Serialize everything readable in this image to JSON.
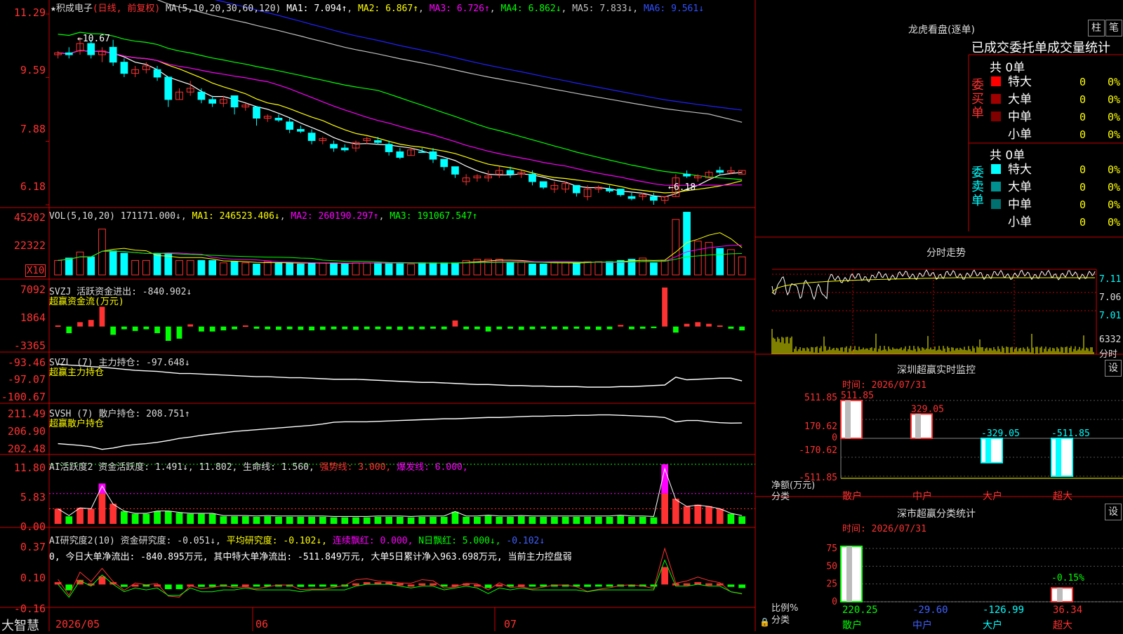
{
  "colors": {
    "up": "#ff3232",
    "down": "#00ffff",
    "grid": "#c80000",
    "ma1": "#ffffff",
    "ma2": "#ffff00",
    "ma3": "#ff00ff",
    "ma4": "#00ff00",
    "ma5": "#c0c0c0",
    "ma6": "#2020ff",
    "text": "#c8c8c8",
    "yellow": "#ffff00",
    "green": "#00ff00"
  },
  "header": {
    "star": "★",
    "title": "积成电子",
    "period": "(日线, 前复权)",
    "ma_label": "MA(5,10,20,30,60,120)",
    "ma1": "MA1: 7.094↑",
    "ma2": "MA2: 6.867↑",
    "ma3": "MA3: 6.726↑",
    "ma4": "MA4: 6.862↓",
    "ma5": "MA5: 7.833↓",
    "ma6": "MA6: 9.561↓"
  },
  "price_axis": [
    "11.29",
    "9.59",
    "7.88",
    "6.18"
  ],
  "annotations": {
    "high": "←10.67",
    "low": "←6.18"
  },
  "vol": {
    "label": "VOL(5,10,20)",
    "value": "171171.000↓",
    "ma1": "MA1: 246523.406↓",
    "ma2": "MA2: 260190.297↑",
    "ma3": "MA3: 191067.547↑",
    "axis": [
      "45202",
      "22322"
    ],
    "unit": "X10"
  },
  "svzj": {
    "label": "SVZJ 活跃资金进出: -840.902↓",
    "sub": "超赢资金流(万元)",
    "axis": [
      "7092",
      "1864",
      "-3365"
    ]
  },
  "svzl": {
    "label": "SVZL (7) 主力持仓: -97.648↓",
    "sub": "超赢主力持仓",
    "axis": [
      "-93.46",
      "-97.07",
      "-100.67"
    ]
  },
  "svsh": {
    "label": "SVSH (7) 散户持仓: 208.751↑",
    "sub": "超赢散户持仓",
    "axis": [
      "211.49",
      "206.90",
      "202.48"
    ]
  },
  "ai1": {
    "label": "AI活跃度2 资金活跃度: 1.491↓, 11.802, 生命线: 1.560,",
    "strong": "强势线: 3.000,",
    "burst": "爆发线: 6.000,",
    "axis": [
      "11.80",
      "5.83",
      "0.00"
    ]
  },
  "ai2": {
    "label": "AI研究度2(10) 资金研究度: -0.051↓,",
    "avg": "平均研究度: -0.102↓,",
    "cont": "连续飘红: 0.000,",
    "n": "N日飘红: 5.000↓,",
    "last": "-0.102↓",
    "line2": "0, 今日大单净流出: -840.895万元, 其中特大单净流出: -511.849万元, 大单5日累计净入963.698万元, 当前主力控盘弱",
    "axis": [
      "0.37",
      "0.10",
      "-0.16"
    ]
  },
  "xaxis": {
    "brand": "大智慧",
    "labels": [
      "2026/05",
      "06",
      "07"
    ]
  },
  "lhb": {
    "title": "龙虎看盘(逐单)",
    "btn1": "柱",
    "btn2": "笔",
    "tab1": "已成交",
    "tab2": "委托单",
    "tab3": "成交量统计",
    "buy": {
      "side": "委买单",
      "total": "共 0单",
      "rows": [
        {
          "name": "特大",
          "v": "0",
          "p": "0%",
          "c": "#ff0000"
        },
        {
          "name": "大单",
          "v": "0",
          "p": "0%",
          "c": "#a00000"
        },
        {
          "name": "中单",
          "v": "0",
          "p": "0%",
          "c": "#800000"
        },
        {
          "name": "小单",
          "v": "0",
          "p": "0%",
          "c": ""
        }
      ]
    },
    "sell": {
      "side": "委卖单",
      "total": "共 0单",
      "rows": [
        {
          "name": "特大",
          "v": "0",
          "p": "0%",
          "c": "#00ffff"
        },
        {
          "name": "大单",
          "v": "0",
          "p": "0%",
          "c": "#009090"
        },
        {
          "name": "中单",
          "v": "0",
          "p": "0%",
          "c": "#007070"
        },
        {
          "name": "小单",
          "v": "0",
          "p": "0%",
          "c": ""
        }
      ]
    }
  },
  "fenshi": {
    "title": "分时走势",
    "axis": [
      "7.11",
      "7.06",
      "7.01"
    ],
    "vol": "6332",
    "unit": "分时"
  },
  "monitor": {
    "title": "深圳超赢实时监控",
    "btn": "设",
    "time": "时间: 2026/07/31",
    "axis": [
      "511.85",
      "170.62",
      "0",
      "-170.62",
      "-511.85"
    ],
    "ylab": "净额(万元)",
    "xlab": "分类",
    "bars": [
      {
        "cat": "散户",
        "v": 511.85,
        "label": "511.85"
      },
      {
        "cat": "中户",
        "v": 329.05,
        "label": "329.05"
      },
      {
        "cat": "大户",
        "v": -329.05,
        "label": "-329.05"
      },
      {
        "cat": "超大",
        "v": -511.85,
        "label": "-511.85"
      }
    ]
  },
  "classify": {
    "title": "深市超赢分类统计",
    "btn": "设",
    "time": "时间: 2026/07/31",
    "axis": [
      "75",
      "50",
      "25",
      "0"
    ],
    "ylab": "比例%",
    "xlab": "分类",
    "bars": [
      {
        "cat": "散户",
        "v": 100,
        "vlabel": "220.25"
      },
      {
        "cat": "中户",
        "v": 0,
        "vlabel": "-29.60"
      },
      {
        "cat": "大户",
        "v": 0,
        "vlabel": "-126.99"
      },
      {
        "cat": "超大",
        "v": 25,
        "vlabel": "36.34",
        "top": "-0.15%"
      }
    ]
  },
  "chart_data": [
    {
      "type": "candlestick",
      "title": "积成电子",
      "ylim": [
        6.18,
        11.29
      ],
      "ohlc": [
        [
          10.2,
          10.3,
          10.1,
          10.25
        ],
        [
          10.25,
          10.4,
          10.1,
          10.2
        ],
        [
          10.3,
          10.67,
          10.2,
          10.5
        ],
        [
          10.5,
          10.6,
          10.1,
          10.2
        ],
        [
          10.2,
          10.4,
          10.0,
          10.3
        ],
        [
          10.4,
          10.6,
          9.9,
          10.0
        ],
        [
          10.0,
          10.1,
          9.6,
          9.7
        ],
        [
          9.7,
          9.9,
          9.6,
          9.8
        ],
        [
          9.8,
          10.0,
          9.7,
          9.9
        ],
        [
          9.8,
          9.9,
          9.5,
          9.6
        ],
        [
          9.6,
          9.6,
          8.8,
          9.0
        ],
        [
          9.0,
          9.3,
          9.0,
          9.2
        ],
        [
          9.2,
          9.5,
          9.1,
          9.3
        ],
        [
          9.2,
          9.3,
          8.9,
          9.0
        ],
        [
          9.0,
          9.1,
          8.8,
          8.9
        ],
        [
          8.9,
          9.1,
          8.8,
          9.0
        ],
        [
          9.1,
          9.1,
          8.6,
          8.8
        ],
        [
          8.8,
          8.9,
          8.7,
          8.85
        ],
        [
          8.8,
          8.8,
          8.3,
          8.5
        ],
        [
          8.5,
          8.6,
          8.4,
          8.55
        ],
        [
          8.5,
          8.6,
          8.4,
          8.45
        ],
        [
          8.4,
          8.5,
          8.1,
          8.2
        ],
        [
          8.2,
          8.3,
          8.1,
          8.15
        ],
        [
          8.1,
          8.2,
          7.8,
          7.9
        ],
        [
          7.9,
          8.0,
          7.8,
          7.95
        ],
        [
          7.8,
          7.9,
          7.6,
          7.7
        ],
        [
          7.7,
          7.8,
          7.6,
          7.65
        ],
        [
          7.7,
          7.9,
          7.6,
          7.85
        ],
        [
          7.9,
          8.0,
          7.8,
          7.95
        ],
        [
          7.9,
          8.0,
          7.8,
          7.85
        ],
        [
          7.8,
          7.9,
          7.5,
          7.6
        ],
        [
          7.6,
          7.7,
          7.4,
          7.45
        ],
        [
          7.5,
          7.7,
          7.5,
          7.65
        ],
        [
          7.6,
          7.7,
          7.6,
          7.58
        ],
        [
          7.6,
          7.7,
          7.3,
          7.4
        ],
        [
          7.4,
          7.4,
          7.1,
          7.2
        ],
        [
          7.2,
          7.2,
          6.9,
          7.0
        ],
        [
          6.8,
          7.0,
          6.7,
          6.9
        ],
        [
          6.9,
          7.0,
          6.8,
          6.95
        ],
        [
          6.9,
          7.1,
          6.8,
          6.95
        ],
        [
          7.0,
          7.2,
          6.9,
          7.1
        ],
        [
          7.1,
          7.2,
          6.9,
          7.0
        ],
        [
          7.0,
          7.1,
          6.9,
          7.05
        ],
        [
          7.0,
          7.1,
          6.7,
          6.8
        ],
        [
          6.8,
          6.8,
          6.6,
          6.65
        ],
        [
          6.6,
          6.8,
          6.5,
          6.7
        ],
        [
          6.6,
          6.8,
          6.5,
          6.75
        ],
        [
          6.7,
          6.7,
          6.4,
          6.5
        ],
        [
          6.4,
          6.7,
          6.3,
          6.6
        ],
        [
          6.6,
          6.7,
          6.5,
          6.65
        ],
        [
          6.6,
          6.7,
          6.5,
          6.55
        ],
        [
          6.6,
          6.6,
          6.4,
          6.45
        ],
        [
          6.4,
          6.5,
          6.3,
          6.35
        ],
        [
          6.4,
          6.5,
          6.3,
          6.45
        ],
        [
          6.4,
          6.5,
          6.18,
          6.3
        ],
        [
          6.3,
          6.4,
          6.2,
          6.4
        ],
        [
          6.4,
          7.0,
          6.4,
          6.9
        ],
        [
          7.0,
          7.1,
          6.9,
          6.95
        ],
        [
          6.9,
          7.0,
          6.8,
          6.95
        ],
        [
          6.9,
          7.1,
          6.9,
          7.05
        ],
        [
          7.1,
          7.2,
          7.0,
          7.05
        ],
        [
          7.05,
          7.2,
          7.0,
          7.09
        ],
        [
          7.0,
          7.1,
          7.0,
          7.1
        ]
      ]
    },
    {
      "type": "bar",
      "title": "VOL",
      "ylim": [
        0,
        50000
      ],
      "values": [
        12000,
        14000,
        19000,
        15000,
        38000,
        20000,
        18000,
        12000,
        12000,
        18000,
        18000,
        12000,
        12000,
        12000,
        12000,
        10000,
        11000,
        10000,
        9000,
        11000,
        10000,
        10000,
        9000,
        10000,
        10000,
        10000,
        9000,
        10000,
        10000,
        10000,
        10000,
        10000,
        9000,
        10000,
        10000,
        10000,
        10000,
        12000,
        13000,
        13000,
        13000,
        10000,
        11000,
        9000,
        9000,
        11000,
        10000,
        10000,
        11000,
        11000,
        11000,
        12000,
        13000,
        14000,
        10000,
        12000,
        46000,
        52000,
        28000,
        27000,
        22000,
        21000,
        15000
      ]
    },
    {
      "type": "bar",
      "title": "SVZJ",
      "ylim": [
        -3365,
        7092
      ],
      "values": [
        200,
        -1200,
        800,
        1200,
        3600,
        -1500,
        -500,
        -800,
        -500,
        -1200,
        -2600,
        -2200,
        400,
        -900,
        -900,
        -700,
        -500,
        200,
        -400,
        -500,
        -600,
        -500,
        -600,
        -700,
        -600,
        -500,
        -500,
        -600,
        -500,
        -500,
        -500,
        -600,
        -500,
        -500,
        -400,
        -500,
        1100,
        -500,
        -500,
        -900,
        -500,
        -400,
        -600,
        -500,
        -400,
        -500,
        -500,
        -400,
        -500,
        -600,
        -500,
        300,
        -500,
        -400,
        -300,
        7092,
        -1100,
        500,
        800,
        500,
        200,
        -400,
        -700
      ]
    },
    {
      "type": "line",
      "title": "SVZL",
      "ylim": [
        -100.67,
        -93.46
      ],
      "values": [
        -94.4,
        -94.6,
        -94.7,
        -94.9,
        -95.0,
        -95.2,
        -95.4,
        -95.6,
        -95.7,
        -95.8,
        -96.0,
        -96.2,
        -96.2,
        -96.3,
        -96.4,
        -96.5,
        -96.6,
        -96.7,
        -96.8,
        -96.8,
        -96.9,
        -97.0,
        -97.0,
        -97.1,
        -97.2,
        -97.3,
        -97.3,
        -97.3,
        -97.4,
        -97.5,
        -97.6,
        -97.7,
        -97.8,
        -97.9,
        -97.9,
        -98.0,
        -98.1,
        -98.2,
        -98.3,
        -98.3,
        -98.4,
        -98.5,
        -98.5,
        -98.6,
        -98.6,
        -98.7,
        -98.7,
        -98.7,
        -98.8,
        -98.8,
        -98.8,
        -98.7,
        -98.7,
        -98.6,
        -98.5,
        -98.4,
        -96.9,
        -97.4,
        -97.3,
        -97.2,
        -97.1,
        -97.1,
        -97.6
      ]
    },
    {
      "type": "line",
      "title": "SVSH",
      "ylim": [
        202.48,
        211.49
      ],
      "values": [
        204.0,
        203.8,
        203.6,
        203.3,
        202.7,
        203.0,
        203.5,
        203.8,
        204.0,
        204.3,
        204.7,
        205.2,
        205.5,
        205.9,
        206.2,
        206.5,
        206.8,
        207.0,
        207.2,
        207.4,
        207.6,
        207.8,
        208.0,
        208.2,
        208.5,
        208.9,
        209.0,
        209.0,
        209.0,
        209.1,
        209.2,
        209.3,
        209.4,
        209.5,
        209.6,
        209.7,
        209.7,
        209.8,
        209.9,
        210.0,
        210.0,
        210.1,
        210.2,
        210.3,
        210.3,
        210.4,
        210.4,
        210.5,
        210.5,
        210.6,
        210.6,
        210.5,
        210.4,
        210.3,
        210.2,
        210.0,
        209.0,
        209.3,
        209.3,
        209.0,
        208.8,
        208.7,
        208.75
      ]
    },
    {
      "type": "bar",
      "title": "AI活跃度2",
      "ylim": [
        0,
        11.8
      ],
      "values": [
        3.0,
        1.5,
        3.2,
        3.0,
        8.0,
        4.0,
        2.5,
        2.0,
        2.0,
        2.5,
        2.5,
        2.2,
        2.0,
        2.0,
        2.0,
        1.5,
        1.5,
        1.5,
        1.4,
        1.5,
        1.4,
        1.4,
        1.4,
        1.4,
        1.4,
        1.3,
        1.3,
        1.3,
        1.3,
        1.4,
        1.4,
        1.4,
        1.3,
        1.4,
        1.4,
        1.4,
        2.4,
        1.4,
        1.4,
        1.6,
        1.4,
        1.4,
        1.5,
        1.4,
        1.4,
        1.4,
        1.4,
        1.4,
        1.4,
        1.4,
        1.4,
        1.6,
        1.4,
        1.4,
        1.3,
        11.8,
        5.0,
        3.5,
        3.8,
        3.5,
        3.0,
        2.0,
        1.5
      ]
    },
    {
      "type": "bar",
      "title": "AI研究度2",
      "ylim": [
        -0.16,
        0.37
      ],
      "values": [
        0.02,
        -0.05,
        0.04,
        0.01,
        0.07,
        0.02,
        -0.02,
        0.0,
        -0.01,
        0.0,
        -0.04,
        -0.04,
        0.0,
        -0.02,
        -0.02,
        -0.01,
        -0.01,
        0.0,
        -0.01,
        -0.01,
        -0.01,
        -0.01,
        -0.02,
        -0.01,
        -0.01,
        -0.01,
        -0.01,
        0.01,
        0.02,
        0.02,
        0.02,
        0.01,
        0.0,
        0.01,
        0.01,
        -0.01,
        0.0,
        0.01,
        0.0,
        -0.03,
        0.0,
        -0.01,
        0.0,
        -0.01,
        -0.01,
        -0.01,
        -0.01,
        -0.01,
        -0.02,
        -0.01,
        -0.01,
        -0.01,
        -0.01,
        -0.01,
        -0.01,
        0.15,
        0.01,
        0.01,
        0.02,
        0.01,
        0.01,
        -0.02,
        -0.03
      ]
    }
  ]
}
